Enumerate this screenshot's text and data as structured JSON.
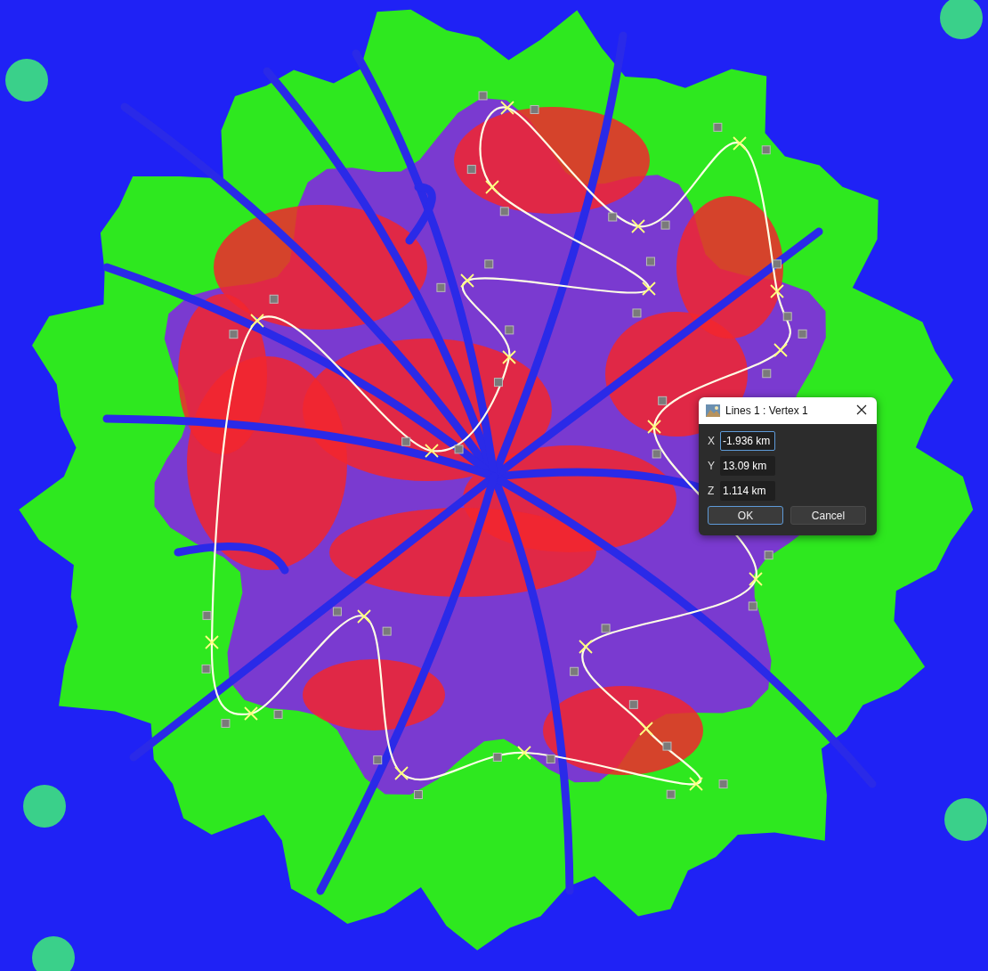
{
  "dialog": {
    "title": "Lines 1 : Vertex 1",
    "fields": [
      {
        "label": "X",
        "value": "-1.936 km",
        "focused": true
      },
      {
        "label": "Y",
        "value": "13.09 km",
        "focused": false
      },
      {
        "label": "Z",
        "value": "1.114 km",
        "focused": false
      }
    ],
    "buttons": [
      {
        "label": "OK",
        "default": true
      },
      {
        "label": "Cancel",
        "default": false
      }
    ]
  }
}
